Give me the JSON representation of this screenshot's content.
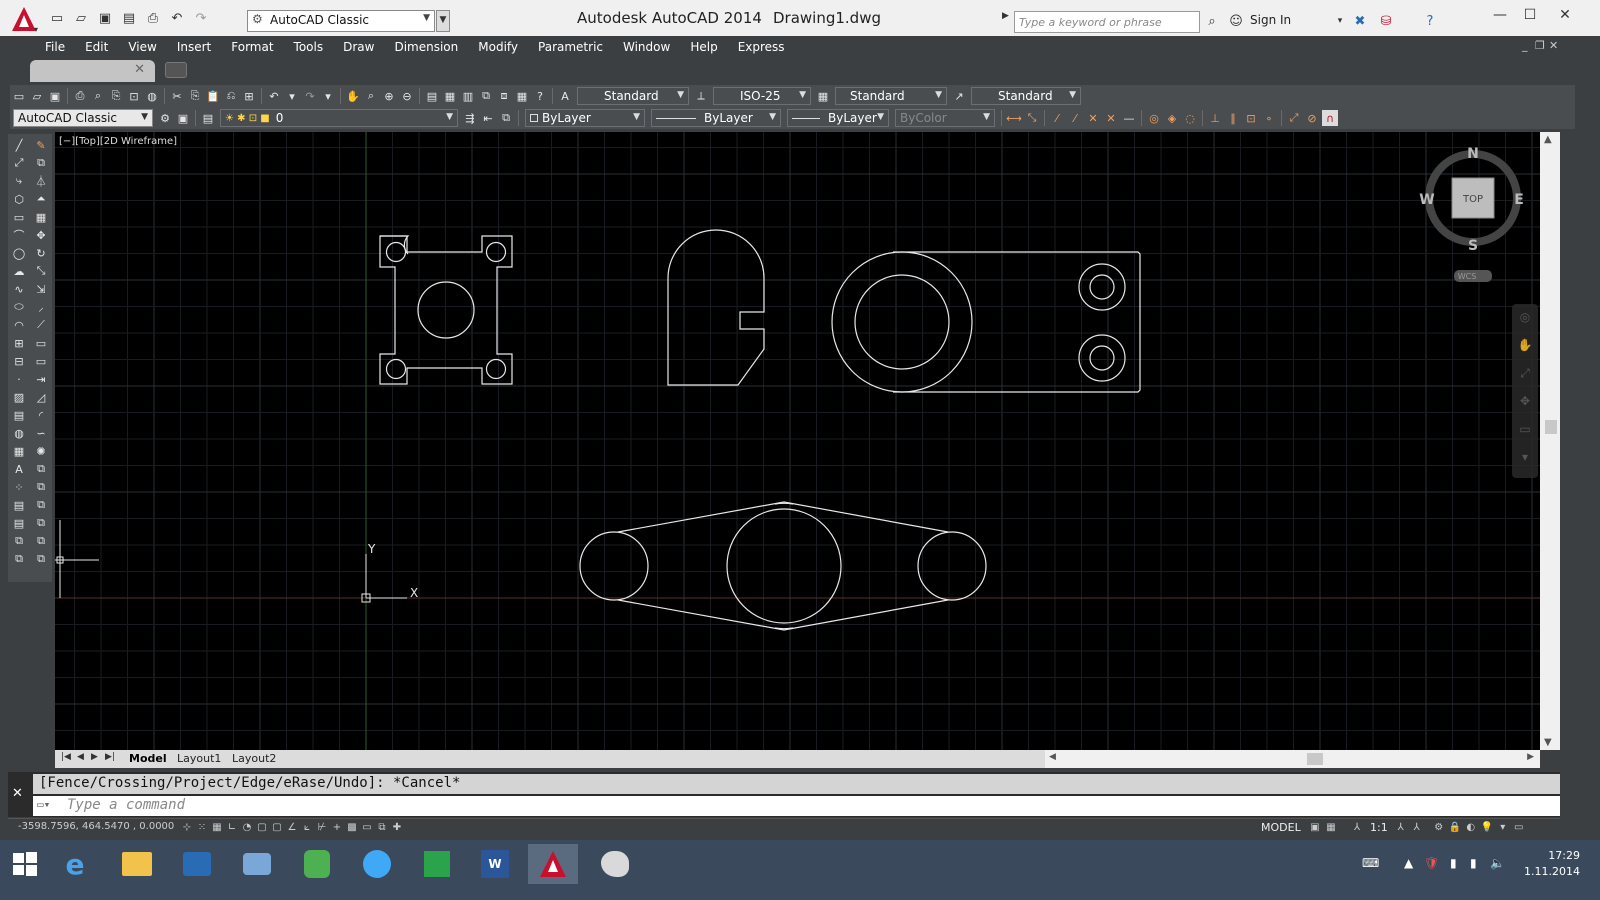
{
  "titlebar": {
    "app_title": "Autodesk AutoCAD 2014",
    "document": "Drawing1.dwg",
    "workspace": "AutoCAD Classic",
    "search_placeholder": "Type a keyword or phrase",
    "sign_in": "Sign In"
  },
  "menu": [
    "File",
    "Edit",
    "View",
    "Insert",
    "Format",
    "Tools",
    "Draw",
    "Dimension",
    "Modify",
    "Parametric",
    "Window",
    "Help",
    "Express"
  ],
  "styles_toolbar": {
    "text_style": "Standard",
    "dim_style": "ISO-25",
    "table_style": "Standard",
    "mleader_style": "Standard"
  },
  "properties_toolbar": {
    "workspace": "AutoCAD Classic",
    "layer": "0",
    "color": "ByLayer",
    "linetype": "ByLayer",
    "lineweight": "ByLayer",
    "plotstyle": "ByColor"
  },
  "viewport": {
    "label": "[−][Top][2D Wireframe]"
  },
  "viewcube": {
    "n": "N",
    "s": "S",
    "e": "E",
    "w": "W",
    "face": "TOP",
    "wcs": "WCS"
  },
  "ucs": {
    "x": "X",
    "y": "Y"
  },
  "layout_tabs": [
    "Model",
    "Layout1",
    "Layout2"
  ],
  "command": {
    "history": "[Fence/Crossing/Project/Edge/eRase/Undo]: *Cancel*",
    "placeholder": "Type a command"
  },
  "status": {
    "coordinates": "-3598.7596, 464.5470 , 0.0000",
    "space": "MODEL",
    "annotation_scale": "1:1"
  },
  "clock": {
    "time": "17:29",
    "date": "1.11.2014"
  },
  "colors": {
    "canvas": "#000000",
    "ui_dark": "#3c3f41",
    "accent_red": "#c8102e"
  },
  "icons": [
    "autocad-logo",
    "new",
    "open",
    "save",
    "saveas",
    "plot",
    "undo",
    "redo",
    "search",
    "sign-in",
    "exchange",
    "help",
    "minimize",
    "maximize",
    "close"
  ]
}
